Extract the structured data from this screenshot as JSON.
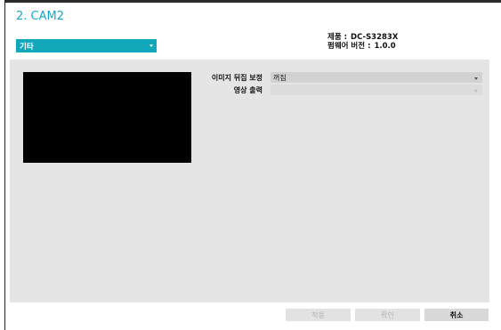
{
  "window": {
    "title": "2. CAM2"
  },
  "category_select": {
    "value": "기타",
    "icon": "chevron-down-icon"
  },
  "info": {
    "product_label": "제품",
    "product_value": "DC-S3283X",
    "firmware_label": "펌웨어 버전",
    "firmware_value": "1.0.0"
  },
  "settings": {
    "flip_label": "이미지 뒤집 보정",
    "flip_value": "꺼짐",
    "output_label": "영상 출력",
    "output_value": ""
  },
  "buttons": {
    "apply": "적용",
    "ok": "확인",
    "cancel": "취소"
  },
  "colors": {
    "accent": "#12a7bb",
    "title": "#17a9c4",
    "panel": "#e5e5e5"
  }
}
